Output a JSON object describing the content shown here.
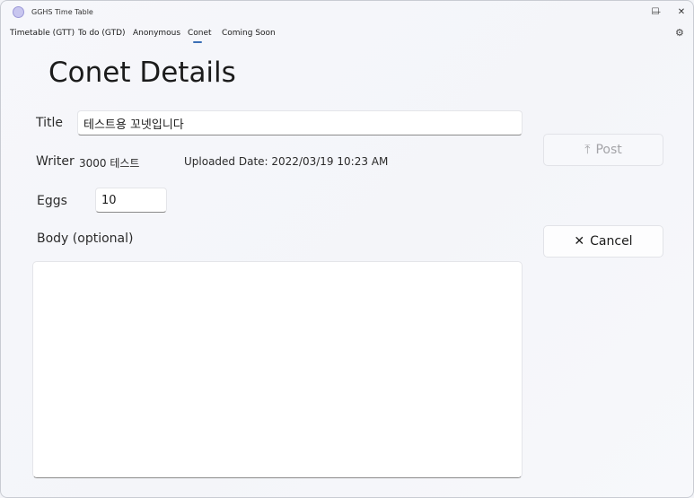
{
  "window": {
    "title": "GGHS Time Table",
    "minimize": "—",
    "maximize": "☐",
    "close": "✕"
  },
  "nav": {
    "items": [
      {
        "label": "Timetable (GTT)"
      },
      {
        "label": "To do (GTD)"
      },
      {
        "label": "Anonymous"
      },
      {
        "label": "Conet",
        "selected": true
      },
      {
        "label": "Coming Soon"
      }
    ],
    "settings_icon": "gear-icon"
  },
  "page": {
    "title": "Conet Details"
  },
  "form": {
    "title_label": "Title",
    "title_value": "테스트용 꼬넷입니다",
    "writer_label": "Writer",
    "writer_value": "3000 테스트",
    "uploaded": "Uploaded Date: 2022/03/19 10:23 AM",
    "eggs_label": "Eggs",
    "eggs_value": "10",
    "body_label": "Body (optional)",
    "body_value": ""
  },
  "buttons": {
    "post": {
      "icon": "⤒",
      "label": "Post",
      "enabled": false
    },
    "cancel": {
      "icon": "✕",
      "label": "Cancel",
      "enabled": true
    }
  },
  "colors": {
    "accent": "#3b6fb5"
  }
}
